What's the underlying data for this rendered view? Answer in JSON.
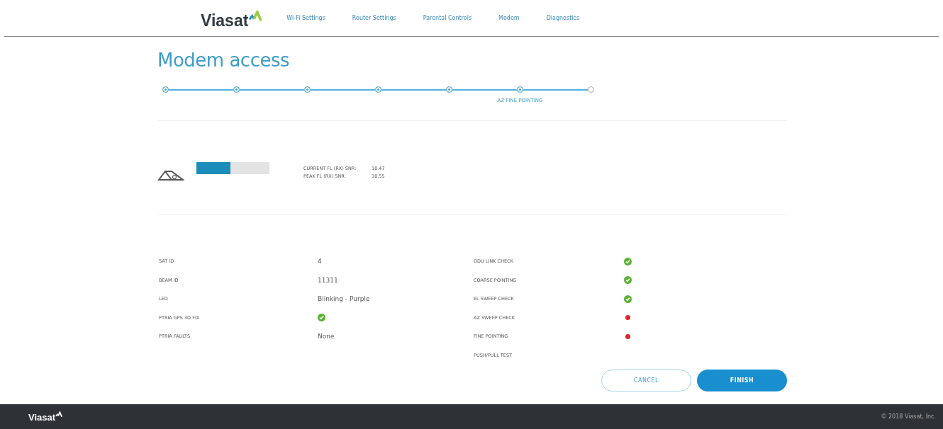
{
  "header": {
    "logo": "Viasat",
    "nav": [
      {
        "label": "Wi-Fi Settings"
      },
      {
        "label": "Router Settings"
      },
      {
        "label": "Parental Controls"
      },
      {
        "label": "Modem"
      },
      {
        "label": "Diagnostics"
      }
    ]
  },
  "page_title": "Modem access",
  "steps": [
    {
      "completed": true
    },
    {
      "completed": true
    },
    {
      "completed": true
    },
    {
      "completed": true
    },
    {
      "completed": true
    },
    {
      "completed": true,
      "label": "AZ FINE POINTING"
    },
    {
      "completed": false
    }
  ],
  "signal": {
    "level": 0.47,
    "readings": [
      {
        "label": "CURRENT FL (RX) SNR:",
        "value": "10.47"
      },
      {
        "label": "PEAK FL (RX) SNR:",
        "value": "10.55"
      }
    ]
  },
  "details": [
    {
      "label": "SAT ID",
      "kind": "text",
      "value": "4"
    },
    {
      "label": "BEAM ID",
      "kind": "text",
      "value": "11311"
    },
    {
      "label": "LED",
      "kind": "text",
      "value": "Blinking - Purple"
    },
    {
      "label": "PTRIA GPS 3D FIX",
      "kind": "status",
      "passed": true
    },
    {
      "label": "PTRIA FAULTS",
      "kind": "text",
      "value": "None"
    }
  ],
  "checks": [
    {
      "label": "ODU LINK CHECK",
      "passed": true
    },
    {
      "label": "COARSE POINTING",
      "passed": true
    },
    {
      "label": "EL SWEEP CHECK",
      "passed": true
    },
    {
      "label": "AZ SWEEP CHECK",
      "passed": false,
      "failed": true
    },
    {
      "label": "FINE POINTING",
      "passed": false,
      "failed": true
    },
    {
      "label": "PUSH/PULL TEST",
      "passed": false,
      "failed": false
    }
  ],
  "buttons": {
    "cancel": "CANCEL",
    "finish": "FINISH"
  },
  "footer": {
    "logo": "Viasat",
    "copyright": "© 2018 Viasat, Inc."
  }
}
